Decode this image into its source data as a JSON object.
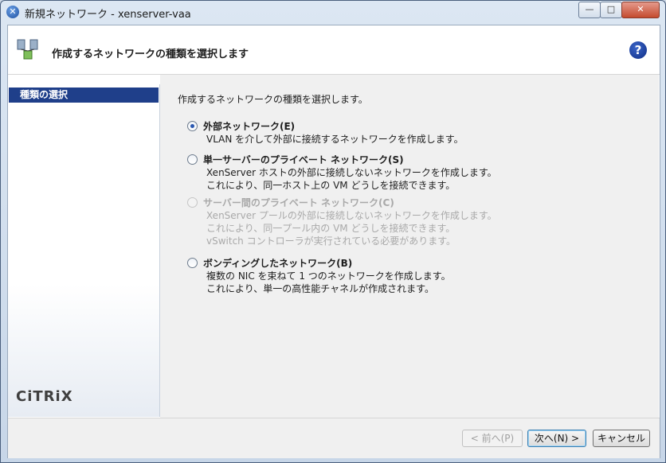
{
  "window": {
    "title": "新規ネットワーク - xenserver-vaa",
    "controls": {
      "minimize": "—",
      "maximize": "□",
      "close": "✕"
    }
  },
  "header": {
    "title": "作成するネットワークの種類を選択します",
    "help": "?"
  },
  "sidebar": {
    "items": [
      {
        "label": "種類の選択",
        "selected": true
      }
    ],
    "logo": "CiTRiX"
  },
  "main": {
    "intro": "作成するネットワークの種類を選択します。",
    "options": [
      {
        "label": "外部ネットワーク(E)",
        "checked": true,
        "enabled": true,
        "desc": [
          "VLAN を介して外部に接続するネットワークを作成します。"
        ]
      },
      {
        "label": "単一サーバーのプライベート ネットワーク(S)",
        "checked": false,
        "enabled": true,
        "desc": [
          "XenServer ホストの外部に接続しないネットワークを作成します。",
          "これにより、同一ホスト上の VM どうしを接続できます。"
        ]
      },
      {
        "label": "サーバー間のプライベート ネットワーク(C)",
        "checked": false,
        "enabled": false,
        "desc": [
          "XenServer プールの外部に接続しないネットワークを作成します。",
          "これにより、同一プール内の VM どうしを接続できます。",
          "vSwitch コントローラが実行されている必要があります。"
        ]
      },
      {
        "label": "ボンディングしたネットワーク(B)",
        "checked": false,
        "enabled": true,
        "desc": [
          "複数の NIC を束ねて 1 つのネットワークを作成します。",
          "これにより、単一の高性能チャネルが作成されます。"
        ]
      }
    ]
  },
  "footer": {
    "back": "< 前へ(P)",
    "next": "次へ(N) >",
    "cancel": "キャンセル"
  },
  "colors": {
    "selection": "#1f3f8a",
    "disabled_text": "#a9a9a9",
    "panel": "#f0f0f0"
  }
}
